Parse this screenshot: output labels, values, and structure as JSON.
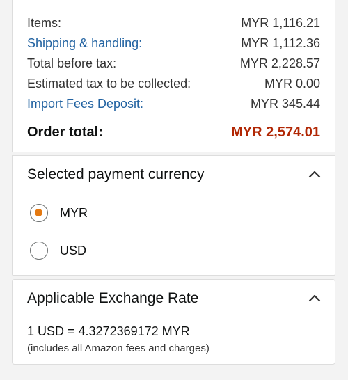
{
  "order_summary": {
    "rows": [
      {
        "label": "Items:",
        "value": "MYR 1,116.21",
        "is_link": false
      },
      {
        "label": "Shipping & handling:",
        "value": "MYR 1,112.36",
        "is_link": true
      },
      {
        "label": "Total before tax:",
        "value": "MYR 2,228.57",
        "is_link": false
      },
      {
        "label": "Estimated tax to be collected:",
        "value": "MYR 0.00",
        "is_link": false
      },
      {
        "label": "Import Fees Deposit:",
        "value": "MYR 345.44",
        "is_link": true
      }
    ],
    "total_label": "Order total:",
    "total_value": "MYR 2,574.01"
  },
  "payment_currency": {
    "title": "Selected payment currency",
    "options": [
      {
        "label": "MYR",
        "selected": true
      },
      {
        "label": "USD",
        "selected": false
      }
    ],
    "expanded": true
  },
  "exchange_rate": {
    "title": "Applicable Exchange Rate",
    "rate_text": "1 USD = 4.3272369172 MYR",
    "note": "(includes all Amazon fees and charges)",
    "expanded": true
  },
  "colors": {
    "link": "#2162a1",
    "total_value": "#b12704",
    "radio_selected": "#e47911",
    "background": "#f3f3f3"
  },
  "icons": {
    "collapse": "chevron-up-icon"
  }
}
